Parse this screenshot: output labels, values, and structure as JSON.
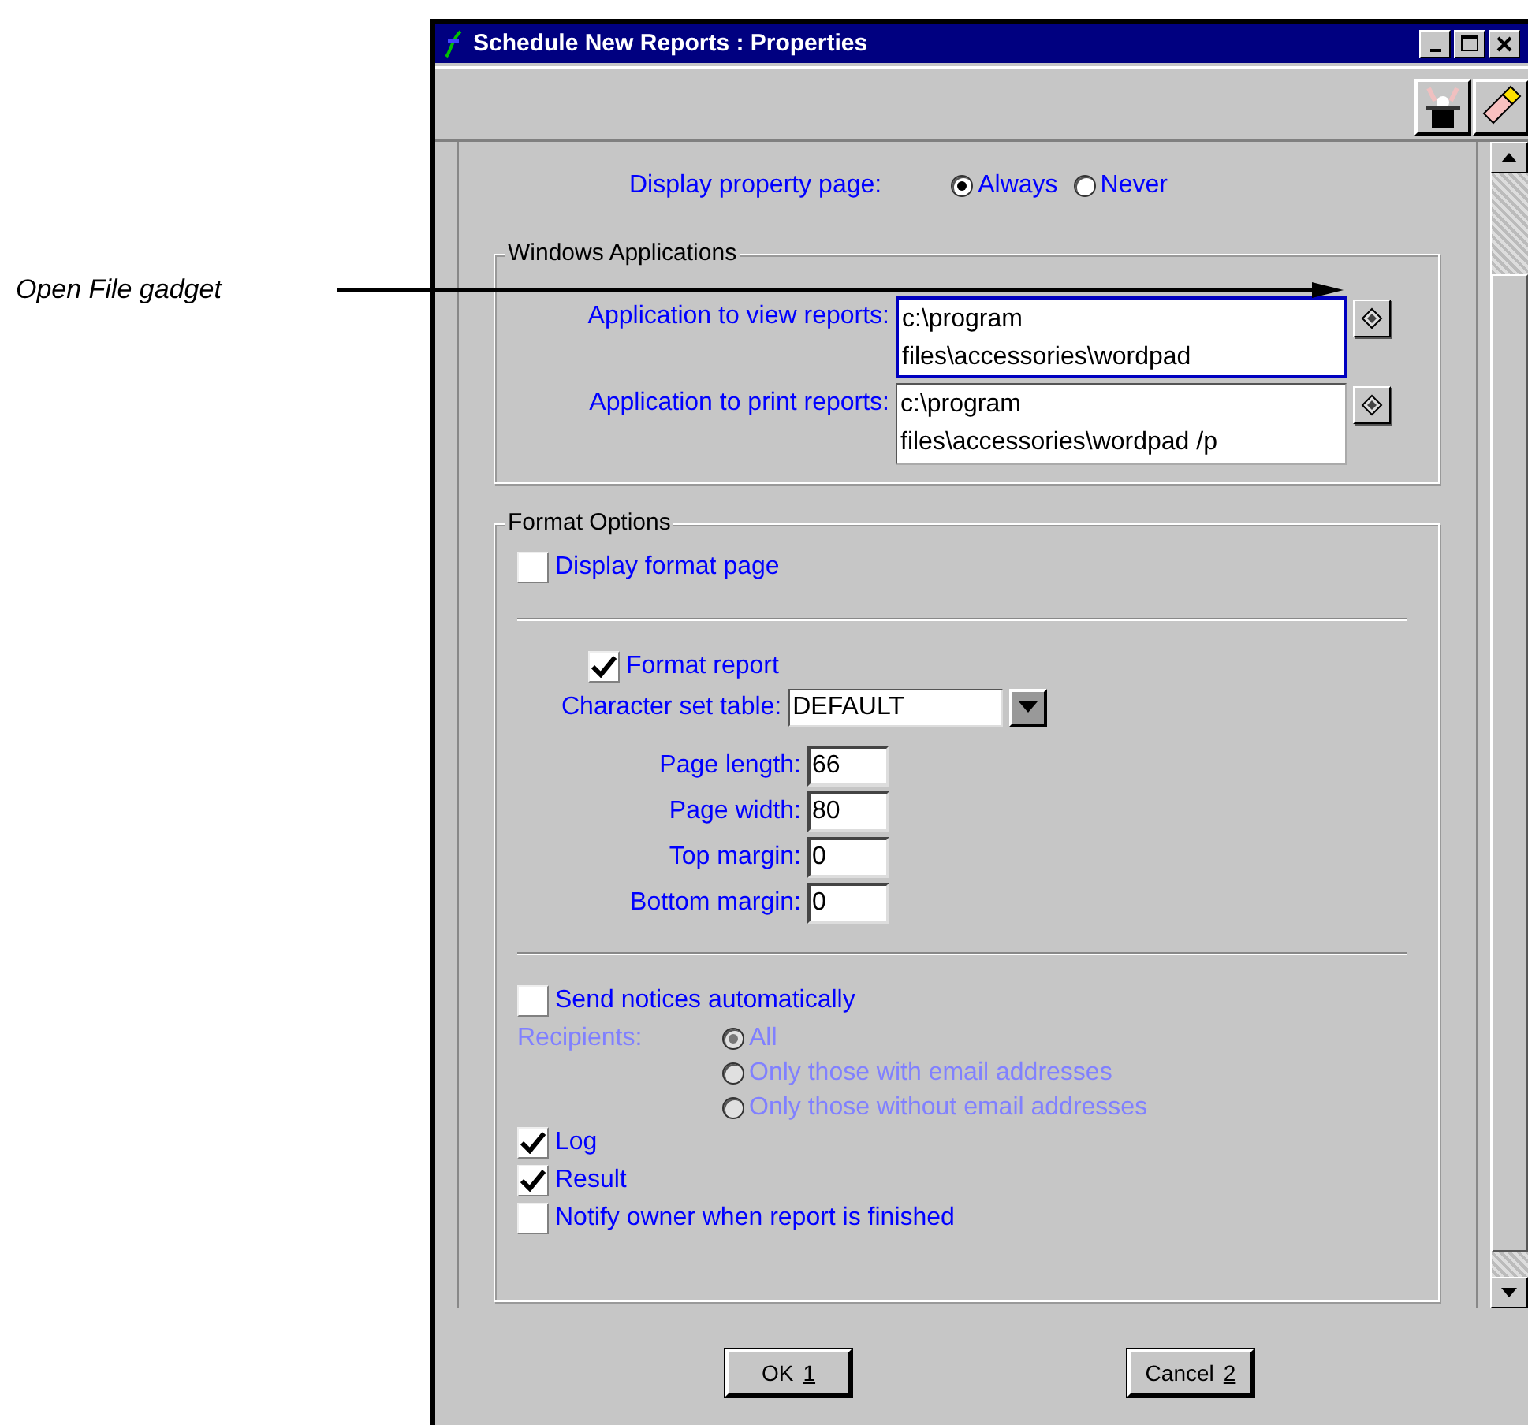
{
  "callout": {
    "label": "Open File gadget"
  },
  "window": {
    "title": "Schedule New Reports : Properties"
  },
  "display_property_page": {
    "label": "Display property page:",
    "options": [
      {
        "label": "Always",
        "selected": true
      },
      {
        "label": "Never",
        "selected": false
      }
    ]
  },
  "windows_applications": {
    "title": "Windows Applications",
    "fields": [
      {
        "label": "Application to view reports:",
        "lines": [
          "c:\\program",
          "files\\accessories\\wordpad"
        ],
        "focused": true
      },
      {
        "label": "Application to print reports:",
        "lines": [
          "c:\\program",
          "files\\accessories\\wordpad /p"
        ],
        "focused": false
      }
    ]
  },
  "format_options": {
    "title": "Format Options",
    "display_format_page": {
      "label": "Display format page",
      "checked": false
    },
    "format_report": {
      "label": "Format report",
      "checked": true
    },
    "character_set": {
      "label": "Character set table:",
      "value": "DEFAULT"
    },
    "page_fields": [
      {
        "label": "Page length:",
        "value": "66"
      },
      {
        "label": "Page width:",
        "value": "80"
      },
      {
        "label": "Top margin:",
        "value": "0"
      },
      {
        "label": "Bottom margin:",
        "value": "0"
      }
    ],
    "send_notices": {
      "label": "Send notices automatically",
      "checked": false
    },
    "recipients": {
      "label": "Recipients:",
      "disabled": true,
      "options": [
        {
          "label": "All",
          "selected": true
        },
        {
          "label": "Only those with email addresses",
          "selected": false
        },
        {
          "label": "Only those without email addresses",
          "selected": false
        }
      ]
    },
    "options": [
      {
        "label": "Log",
        "checked": true
      },
      {
        "label": "Result",
        "checked": true
      },
      {
        "label": "Notify owner when report is finished",
        "checked": false
      }
    ]
  },
  "buttons": [
    {
      "label": "OK",
      "key": "1"
    },
    {
      "label": "Cancel",
      "key": "2"
    }
  ]
}
